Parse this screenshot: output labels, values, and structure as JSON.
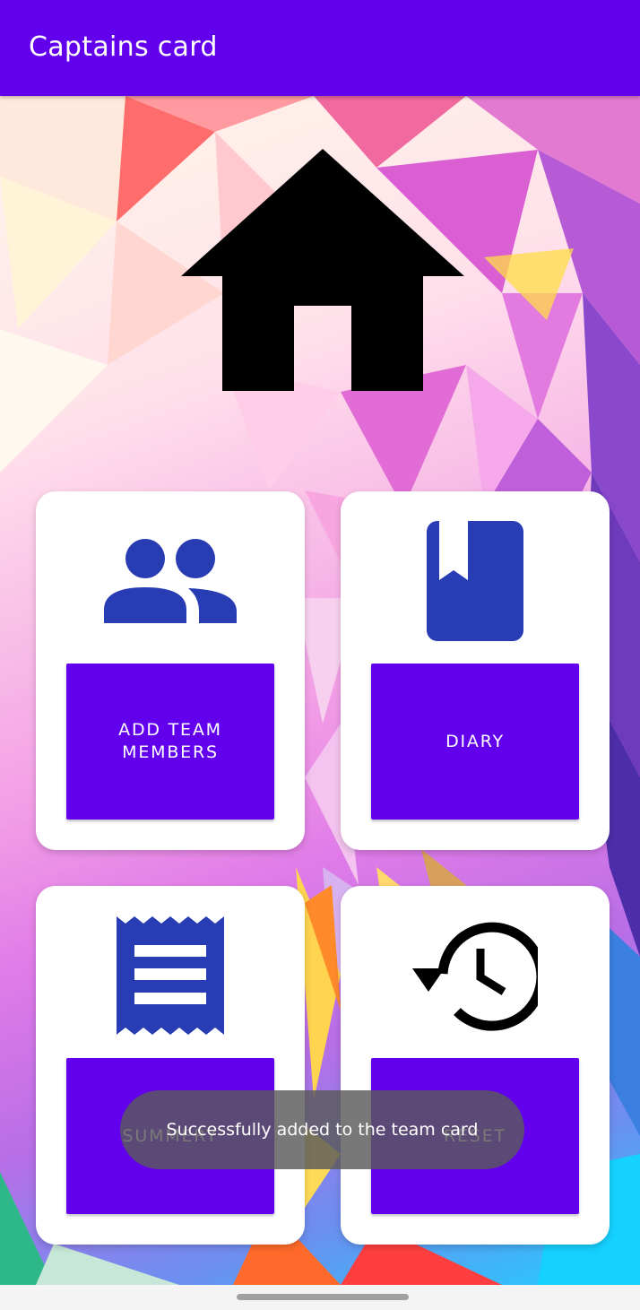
{
  "app_bar": {
    "title": "Captains card"
  },
  "colors": {
    "primary": "#6200ee",
    "icon_blue": "#283cb4",
    "toast_bg": "#5a5a5a",
    "card_bg": "#ffffff"
  },
  "header_icon": "home-icon",
  "cards": [
    {
      "icon": "group-icon",
      "button_label": "ADD TEAM MEMBERS"
    },
    {
      "icon": "book-bookmark-icon",
      "button_label": "DIARY"
    },
    {
      "icon": "receipt-icon",
      "button_label": "SUMMERY"
    },
    {
      "icon": "history-restore-icon",
      "button_label": "RESET"
    }
  ],
  "toast": {
    "message": "Successfully added to the team card"
  }
}
